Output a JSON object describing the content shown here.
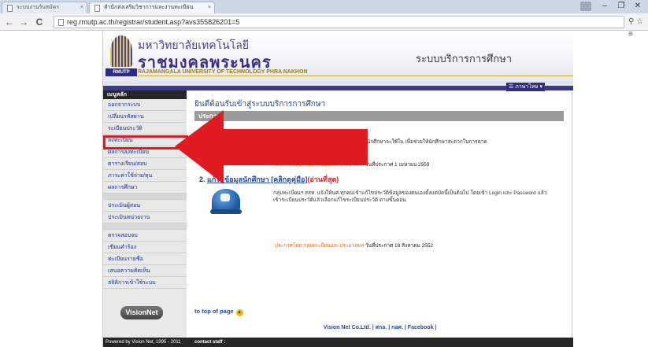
{
  "browser": {
    "tabs": [
      {
        "label": "ระบบงานรับสมัคร"
      },
      {
        "label": "สำนักส่งเสริมวิชาการและงานทะเบียน"
      }
    ],
    "url": "reg.rmutp.ac.th/registrar/student.asp?avs355826201=5",
    "window_controls": {
      "minimize": "–",
      "maximize": "❐",
      "close": "✕"
    },
    "nav": {
      "back": "←",
      "forward": "→",
      "reload": "C"
    },
    "toolbar_icons": "⚲ ☆ ≡"
  },
  "header": {
    "university_th_line1": "มหาวิทยาลัยเทคโนโลยี",
    "university_th_line2": "ราชมงคลพระนคร",
    "university_en": "RAJAMANGALA UNIVERSITY OF TECHNOLOGY PHRA NAKHON",
    "logo_tag": "RMUTP",
    "system_title": "ระบบบริการการศึกษา",
    "language_menu": "☰ ภาษาไทย ▾"
  },
  "sidebar": {
    "heading": "เมนูหลัก",
    "group1": [
      {
        "label": "ออกจากระบบ"
      },
      {
        "label": "เปลี่ยนรหัสผ่าน"
      },
      {
        "label": "ระเบียนประวัติ"
      },
      {
        "label": "ลงทะเบียน"
      },
      {
        "label": "ผลการลงทะเบียน"
      },
      {
        "label": "ตารางเรียน/สอบ"
      },
      {
        "label": "ภาระค่าใช้จ่าย/ทุน"
      },
      {
        "label": "ผลการศึกษา"
      }
    ],
    "group2": [
      {
        "label": "ประเมินผู้สอน"
      },
      {
        "label": "ประเมินหน่วยงาน"
      }
    ],
    "group3": [
      {
        "label": "ตรวจสอบจบ"
      },
      {
        "label": "เขียนคำร้อง"
      },
      {
        "label": "ทะเบียนรายชื่อ"
      },
      {
        "label": "เสนอความคิดเห็น"
      },
      {
        "label": "สถิติการเข้าใช้ระบบ"
      }
    ],
    "vendor_logo": "VisionNet",
    "footer": "Powered by Vision Net, 1995 - 2011"
  },
  "content": {
    "welcome": "ยินดีต้อนรับเข้าสู่ระบบบริการการศึกษา",
    "news_header": "ประกาศ",
    "news1": {
      "title": "1. ป",
      "text": "ล่วงหน้า ที่คาดว่านักศึกษาจะใช้ใน เพื่อช่วยให้นักศึกษาสะดวกในการคาด",
      "meta_by": "ประกาศโดย กลุ่มทะเบียนและประมวลผล",
      "meta_date": "วันที่ประกาศ 1 เมษายน 2559"
    },
    "news2": {
      "number": "2.",
      "link": "แก้ไขข้อมูลนักศึกษา [คลิกดูคู่มือ]",
      "tag": "(อ่านที่สุด)",
      "text": "กลุ่มทะเบียนฯ สสท. แจ้งให้นศ.ทุกคนเข้าแก้ไขประวัติข้อมูลของตนเองตั้งแต่บัดนี้เป็นต้นไป โดยเข้า Login และ Password แล้วเข้าระเบียนประวัติแล้วเลือกแก้ไขระเบียนประวัติ ตามขั้นตอน",
      "meta_by": "ประกาศโดย กลุ่มทะเบียนและประมวลผล",
      "meta_date": "วันที่ประกาศ 18 สิงหาคม 2552"
    },
    "to_top": "to top of page",
    "to_top_icon": "▲",
    "footer_links": "Vision Net Co.Ltd. | สกอ. | กอศ. | Facebook |",
    "footer_contact_label": "contact staff :",
    "footer_contact_value": ""
  },
  "colors": {
    "highlight": "#e11b22",
    "arrow": "#e11b22",
    "link": "#274b97"
  }
}
